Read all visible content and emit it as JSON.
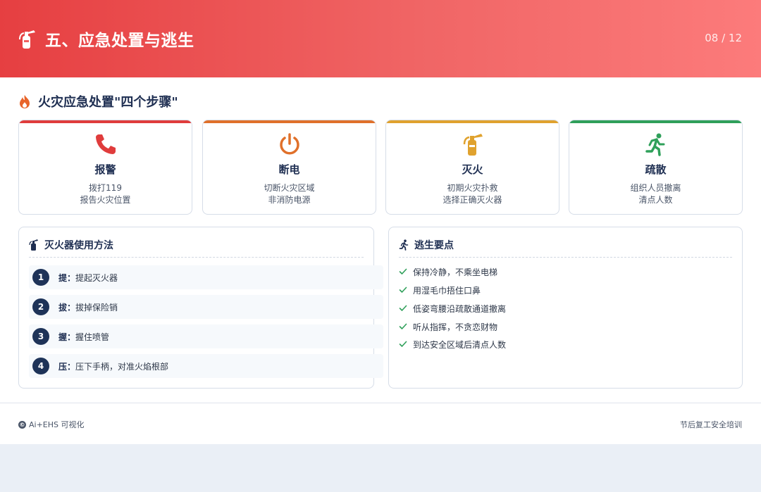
{
  "header": {
    "title": "五、应急处置与逃生",
    "page_indicator": "08 / 12",
    "icon": "fire-extinguisher-icon"
  },
  "section": {
    "title": "火灾应急处置\"四个步骤\"",
    "icon": "fire-icon"
  },
  "steps": [
    {
      "title": "报警",
      "line1": "拨打119",
      "line2": "报告火灾位置",
      "icon": "phone-icon",
      "color": "#e03c3c"
    },
    {
      "title": "断电",
      "line1": "切断火灾区域",
      "line2": "非消防电源",
      "icon": "power-icon",
      "color": "#e0702a"
    },
    {
      "title": "灭火",
      "line1": "初期火灾扑救",
      "line2": "选择正确灭火器",
      "icon": "fire-extinguisher-icon",
      "color": "#e0a22e"
    },
    {
      "title": "疏散",
      "line1": "组织人员撤离",
      "line2": "清点人数",
      "icon": "running-person-icon",
      "color": "#2fa05a"
    }
  ],
  "extinguisher": {
    "title": "灭火器使用方法",
    "items": [
      {
        "num": "1",
        "key": "提：",
        "desc": "提起灭火器"
      },
      {
        "num": "2",
        "key": "拔：",
        "desc": "拔掉保险销"
      },
      {
        "num": "3",
        "key": "握：",
        "desc": "握住喷管"
      },
      {
        "num": "4",
        "key": "压：",
        "desc": "压下手柄，对准火焰根部"
      }
    ]
  },
  "escape": {
    "title": "逃生要点",
    "items": [
      "保持冷静，不乘坐电梯",
      "用湿毛巾捂住口鼻",
      "低姿弯腰沿疏散通道撤离",
      "听从指挥，不贪恋财物",
      "到达安全区域后清点人数"
    ]
  },
  "footer": {
    "left": "Ai+EHS 可视化",
    "right": "节后复工安全培训"
  }
}
